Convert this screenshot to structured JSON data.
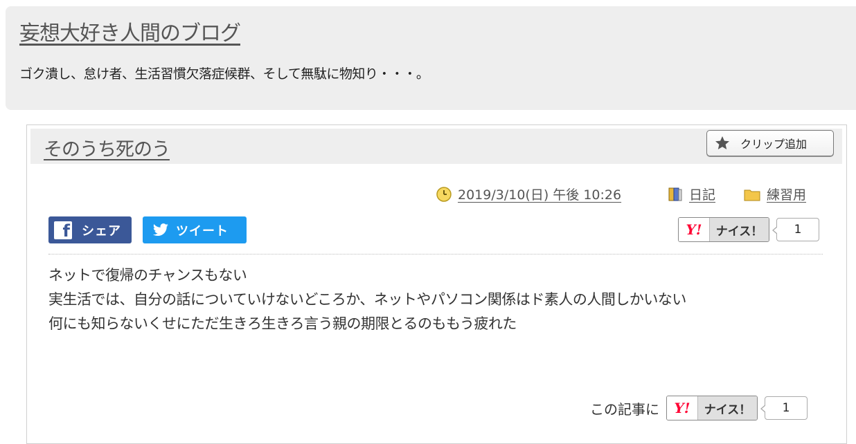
{
  "blog": {
    "title": "妄想大好き人間のブログ",
    "description": "ゴク潰し、怠け者、生活習慣欠落症候群、そして無駄に物知り・・・。"
  },
  "article": {
    "title": "そのうち死のう",
    "clip_label": "クリップ追加",
    "date": "2019/3/10(日) 午後 10:26",
    "category": "日記",
    "folder": "練習用",
    "share": {
      "facebook_label": "シェア",
      "twitter_label": "ツイート"
    },
    "nice": {
      "label": "ナイス！",
      "y_logo": "Y!",
      "count_top": "1",
      "caption_bottom": "この記事に",
      "count_bottom": "1"
    },
    "body": [
      "ネットで復帰のチャンスもない",
      "実生活では、自分の話についていけないどころか、ネットやパソコン関係はド素人の人間しかいない",
      "何にも知らないくせにただ生きろ生きろ言う親の期限とるのももう疲れた"
    ]
  },
  "colors": {
    "header_bg": "#eeeeee",
    "facebook": "#3b5898",
    "twitter": "#1d9bf0",
    "yahoo_red": "#ff0033"
  },
  "icons": {
    "clip": "star-icon",
    "date": "clock-icon",
    "category": "book-icon",
    "folder": "folder-icon",
    "facebook": "facebook-icon",
    "twitter": "twitter-bird-icon"
  }
}
